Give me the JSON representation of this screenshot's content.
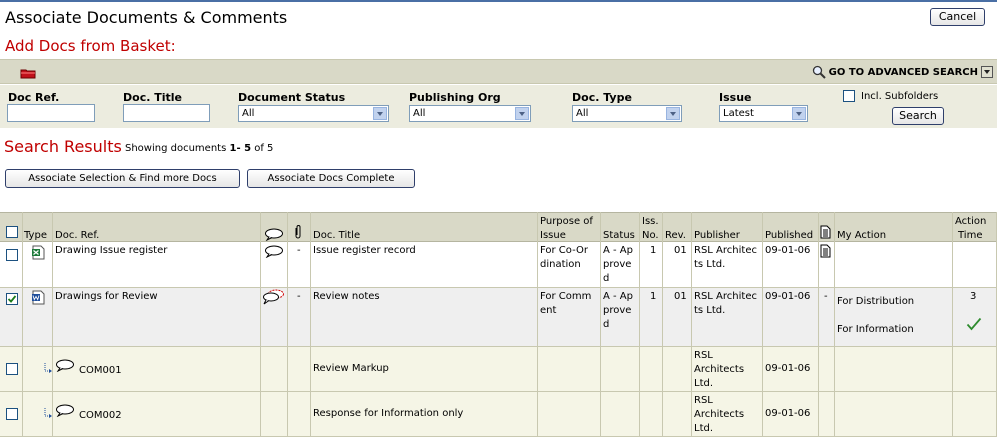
{
  "window": {
    "title": "Associate Documents & Comments",
    "cancel_label": "Cancel"
  },
  "page": {
    "subtitle": "Add Docs from Basket:"
  },
  "toolbar": {
    "advanced_search_label": "GO TO ADVANCED SEARCH"
  },
  "filters": {
    "doc_ref_label": "Doc Ref.",
    "doc_title_label": "Doc. Title",
    "document_status_label": "Document Status",
    "document_status_value": "All",
    "publishing_org_label": "Publishing Org",
    "publishing_org_value": "All",
    "doc_type_label": "Doc. Type",
    "doc_type_value": "All",
    "issue_label": "Issue",
    "issue_value": "Latest",
    "subfolders_label": "Incl. Subfolders",
    "search_label": "Search"
  },
  "results": {
    "title": "Search Results",
    "showing_prefix": "Showing documents",
    "range": "1- 5",
    "of_text": "of 5",
    "associate_more_label": "Associate Selection & Find more Docs",
    "associate_complete_label": "Associate Docs Complete"
  },
  "columns": {
    "type": "Type",
    "doc_ref": "Doc. Ref.",
    "doc_title": "Doc. Title",
    "purpose_line1": "Purpose of",
    "purpose_line2": "Issue",
    "status": "Status",
    "iss_line1": "Iss.",
    "iss_line2": "No.",
    "rev": "Rev.",
    "publisher": "Publisher",
    "published": "Published",
    "my_action": "My Action",
    "action_time_line1": "Action",
    "action_time_line2": "Time"
  },
  "rows": [
    {
      "doc_ref": "Drawing Issue register",
      "attach": "-",
      "doc_title": "Issue register record",
      "purpose": [
        "For Co-Or",
        "dination"
      ],
      "status": [
        "A - Ap",
        "prove",
        "d"
      ],
      "iss_no": "1",
      "rev": "01",
      "publisher": [
        "RSL Architec",
        "ts Ltd."
      ],
      "published": "09-01-06",
      "checked": false,
      "type_icon": "excel-doc-icon",
      "comment_icon": "comment-bubble-icon"
    },
    {
      "doc_ref": "Drawings for Review",
      "attach": "-",
      "doc_title": "Review notes",
      "purpose": [
        "For Comm",
        "ent"
      ],
      "status": [
        "A - Ap",
        "prove",
        "d"
      ],
      "iss_no": "1",
      "rev": "01",
      "publisher": [
        "RSL Architec",
        "ts Ltd."
      ],
      "published": "09-01-06",
      "dash": "-",
      "actions": [
        "For Distribution",
        "For Information"
      ],
      "action_time": "3",
      "checked": true,
      "type_icon": "word-doc-icon",
      "comment_icon": "comment-bubble-red-icon"
    },
    {
      "doc_ref": "COM001",
      "doc_title": "Review Markup",
      "publisher": [
        "RSL",
        "Architects",
        "Ltd."
      ],
      "published": "09-01-06",
      "checked": false
    },
    {
      "doc_ref": "COM002",
      "doc_title": "Response for Information only",
      "publisher": [
        "RSL",
        "Architects",
        "Ltd."
      ],
      "published": "09-01-06",
      "checked": false
    }
  ],
  "colors": {
    "accent_red": "#c00000",
    "header_bg": "#d9d9c7",
    "filter_bg": "#ececdf",
    "comment_row_bg": "#f5f5e6",
    "check_green": "#2e8b2e"
  }
}
